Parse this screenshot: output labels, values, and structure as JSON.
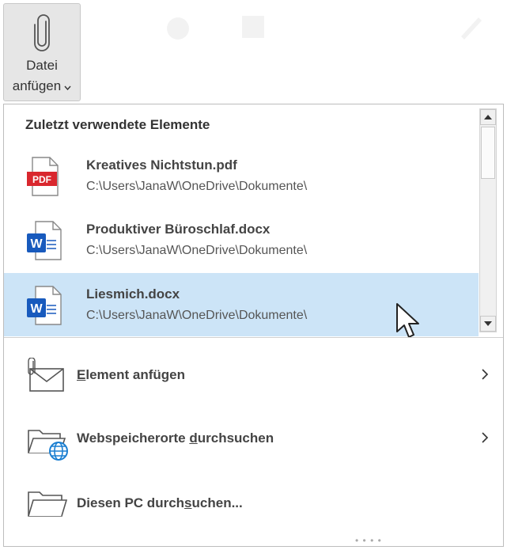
{
  "ribbon": {
    "attach_button": {
      "line1": "Datei",
      "line2": "anfügen",
      "icon": "paperclip-icon"
    }
  },
  "dropdown": {
    "section_title": "Zuletzt verwendete Elemente",
    "recent_items": [
      {
        "name": "Kreatives Nichtstun.pdf",
        "path": "C:\\Users\\JanaW\\OneDrive\\Dokumente\\",
        "icon": "pdf-file-icon",
        "selected": false
      },
      {
        "name": "Produktiver Büroschlaf.docx",
        "path": "C:\\Users\\JanaW\\OneDrive\\Dokumente\\",
        "icon": "word-file-icon",
        "selected": false
      },
      {
        "name": "Liesmich.docx",
        "path": "C:\\Users\\JanaW\\OneDrive\\Dokumente\\",
        "icon": "word-file-icon",
        "selected": true
      }
    ],
    "actions": [
      {
        "label_underlined": "E",
        "label_rest": "lement anfügen",
        "icon": "attach-item-icon",
        "submenu": true
      },
      {
        "label_pre": "Webspeicherorte ",
        "label_underlined": "d",
        "label_rest": "urchsuchen",
        "icon": "web-folder-icon",
        "submenu": true
      },
      {
        "label_pre": "Diesen PC durch",
        "label_underlined": "s",
        "label_rest": "uchen...",
        "icon": "folder-icon",
        "submenu": false
      }
    ]
  },
  "colors": {
    "selected_bg": "#cce4f7",
    "pdf_red": "#d9272e",
    "word_blue": "#185abd",
    "web_globe": "#1b7fd1"
  }
}
